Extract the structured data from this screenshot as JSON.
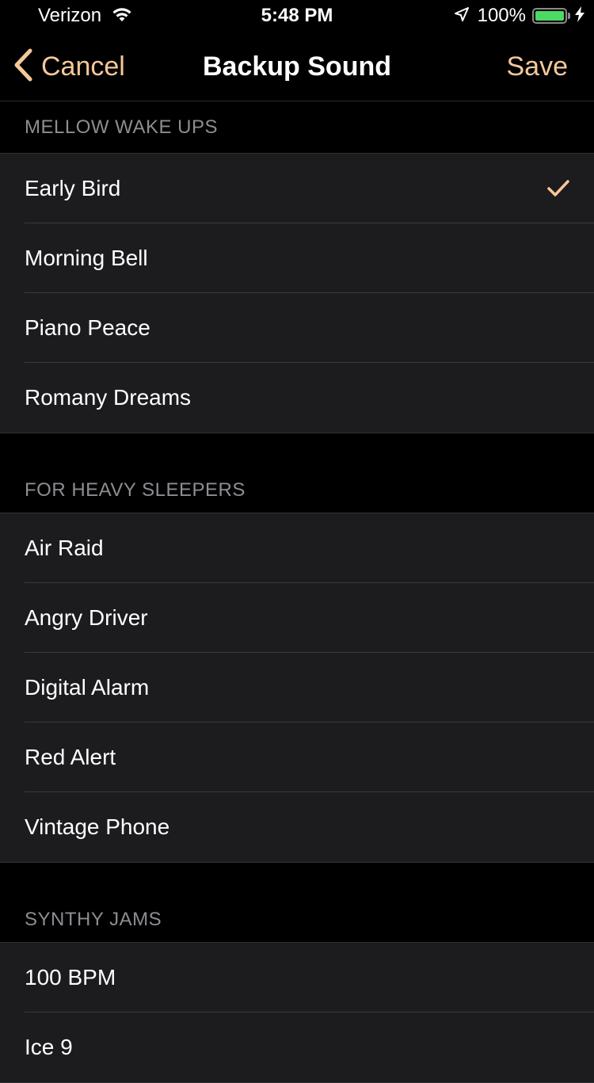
{
  "status_bar": {
    "carrier": "Verizon",
    "time": "5:48 PM",
    "battery_percent": "100%",
    "battery_level": 1.0,
    "signal_bars": 3,
    "signal_total": 4
  },
  "nav": {
    "back_label": "Cancel",
    "title": "Backup Sound",
    "save_label": "Save"
  },
  "colors": {
    "accent": "#f5c89a",
    "battery": "#4cd964",
    "background": "#000000",
    "cell": "#1c1c1e"
  },
  "icons": {
    "back": "chevron-left-icon",
    "check": "checkmark-icon",
    "wifi": "wifi-icon",
    "location": "location-arrow-icon",
    "charging": "bolt-icon"
  },
  "sections": [
    {
      "header": "MELLOW WAKE UPS",
      "items": [
        {
          "label": "Early Bird",
          "selected": true
        },
        {
          "label": "Morning Bell",
          "selected": false
        },
        {
          "label": "Piano Peace",
          "selected": false
        },
        {
          "label": "Romany Dreams",
          "selected": false
        }
      ]
    },
    {
      "header": "FOR HEAVY SLEEPERS",
      "items": [
        {
          "label": "Air Raid",
          "selected": false
        },
        {
          "label": "Angry Driver",
          "selected": false
        },
        {
          "label": "Digital Alarm",
          "selected": false
        },
        {
          "label": "Red Alert",
          "selected": false
        },
        {
          "label": "Vintage Phone",
          "selected": false
        }
      ]
    },
    {
      "header": "SYNTHY JAMS",
      "items": [
        {
          "label": "100 BPM",
          "selected": false
        },
        {
          "label": "Ice 9",
          "selected": false
        }
      ]
    }
  ]
}
